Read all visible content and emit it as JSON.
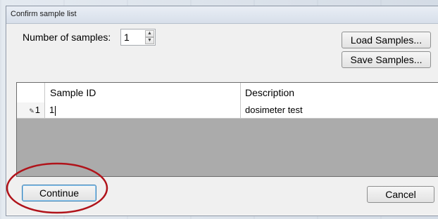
{
  "window": {
    "title": "Confirm sample list"
  },
  "samples": {
    "label": "Number of samples:",
    "count": "1"
  },
  "buttons": {
    "load": "Load Samples...",
    "save": "Save Samples...",
    "continue": "Continue",
    "cancel": "Cancel"
  },
  "table": {
    "columns": [
      "Sample ID",
      "Description"
    ],
    "rows": [
      {
        "row_header": "1",
        "sample_id": "1",
        "description": "dosimeter test"
      }
    ]
  },
  "colors": {
    "annotation": "#b0131a",
    "grid_empty": "#ababab",
    "focus_border": "#3c7fb1"
  }
}
